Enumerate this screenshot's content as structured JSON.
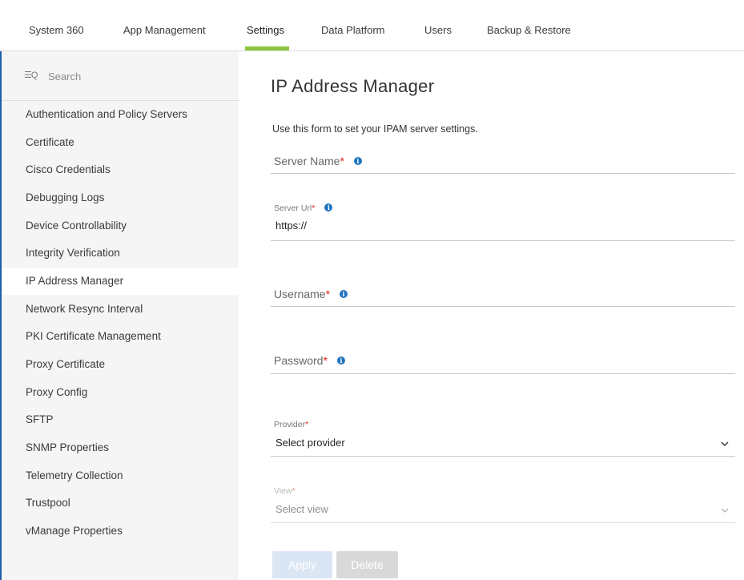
{
  "topnav": {
    "tabs": [
      "System 360",
      "App Management",
      "Settings",
      "Data Platform",
      "Users",
      "Backup & Restore"
    ],
    "active": "Settings"
  },
  "sidebar": {
    "search_placeholder": "Search",
    "items": [
      "Authentication and Policy Servers",
      "Certificate",
      "Cisco Credentials",
      "Debugging Logs",
      "Device Controllability",
      "Integrity Verification",
      "IP Address Manager",
      "Network Resync Interval",
      "PKI Certificate Management",
      "Proxy Certificate",
      "Proxy Config",
      "SFTP",
      "SNMP Properties",
      "Telemetry Collection",
      "Trustpool",
      "vManage Properties"
    ],
    "active": "IP Address Manager"
  },
  "main": {
    "title": "IP Address Manager",
    "description": "Use this form to set your IPAM server settings.",
    "server_name": {
      "label": "Server Name",
      "required": "*",
      "value": ""
    },
    "server_url": {
      "label": "Server Url",
      "required": "*",
      "value": "https://"
    },
    "username": {
      "label": "Username",
      "required": "*",
      "value": ""
    },
    "password": {
      "label": "Password",
      "required": "*",
      "value": ""
    },
    "provider": {
      "label": "Provider",
      "required": "*",
      "value": "Select provider"
    },
    "view": {
      "label": "View",
      "required": "*",
      "value": "Select view",
      "disabled": true
    },
    "apply_label": "Apply",
    "delete_label": "Delete"
  },
  "colors": {
    "accent_green": "#8cc63f",
    "info_blue": "#1e73be",
    "required_red": "#e2231a",
    "frame_blue": "#1f5fa8"
  }
}
